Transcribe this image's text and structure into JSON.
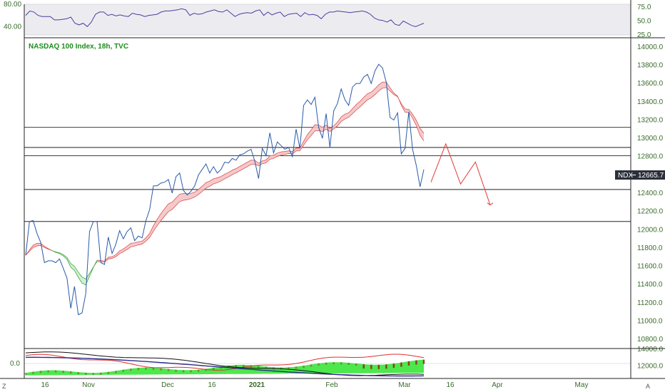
{
  "title": "NASDAQ 100 Index, 18h, TVC",
  "badge": {
    "symbol": "NDX",
    "price": "12665.7"
  },
  "corner_buttons": {
    "left": "Z",
    "right": "A"
  },
  "colors": {
    "price": "#2b5aa8",
    "rsi": "#4b3d9c",
    "ribbon_up_fill": "#c9eec9",
    "ribbon_up_stroke": "#2e9b2e",
    "ribbon_down_fill": "#f3bfbf",
    "ribbon_down_stroke": "#d64040",
    "projection": "#e23a3a",
    "levels": "#222222",
    "histogram": "#39e639",
    "histogram_dark": "#9b1b1b",
    "indicator_line1": "#e03030",
    "indicator_line2": "#111111",
    "indicator_line3": "#2d2a8a",
    "axis_text": "#3a6b2c"
  },
  "chart_data": [
    {
      "type": "line",
      "panel": "rsi",
      "y_ticks": [
        "80.00",
        "40.00"
      ],
      "right_ticks": [
        "75.0",
        "50.0",
        "25.0"
      ],
      "ylim": [
        25,
        80
      ],
      "values": [
        60,
        68,
        66,
        60,
        58,
        58,
        58,
        52,
        52,
        53,
        54,
        57,
        46,
        43,
        46,
        40,
        48,
        62,
        66,
        66,
        60,
        62,
        59,
        61,
        59,
        58,
        64,
        62,
        61,
        58,
        60,
        61,
        62,
        66,
        68,
        68,
        69,
        70,
        72,
        70,
        60,
        64,
        62,
        63,
        66,
        68,
        70,
        67,
        66,
        70,
        64,
        58,
        62,
        64,
        65,
        64,
        68,
        70,
        60,
        66,
        61,
        64,
        66,
        58,
        62,
        63,
        64,
        58,
        65,
        61,
        62,
        60,
        54,
        62,
        66,
        66,
        68,
        67,
        66,
        65,
        66,
        67,
        68,
        66,
        62,
        55,
        52,
        51,
        48,
        52,
        44,
        42,
        50,
        46,
        42,
        40,
        43,
        46
      ]
    },
    {
      "type": "line",
      "panel": "price",
      "xlabel": "",
      "ylabel": "",
      "y_ticks": [
        "14000.0",
        "13800.0",
        "13600.0",
        "13400.0",
        "13200.0",
        "13000.0",
        "12800.0",
        "12600.0",
        "12400.0",
        "12200.0",
        "12000.0",
        "11800.0",
        "11600.0",
        "11400.0",
        "11200.0",
        "11000.0",
        "10800.0"
      ],
      "ylim": [
        10700,
        14100
      ],
      "x_ticks": [
        "16",
        "Nov",
        "Dec",
        "16",
        "2021",
        "Feb",
        "Mar",
        "16",
        "Apr",
        "May"
      ],
      "series": [
        {
          "role": "price",
          "values": [
            11720,
            12090,
            12100,
            11960,
            11860,
            11640,
            11660,
            11660,
            11640,
            11680,
            11580,
            11470,
            11140,
            11380,
            11070,
            11090,
            11300,
            11980,
            12090,
            12090,
            11640,
            11620,
            11920,
            11740,
            11840,
            11990,
            11900,
            11980,
            12020,
            11880,
            11930,
            11910,
            12100,
            12220,
            12480,
            12480,
            12510,
            12520,
            12550,
            12400,
            12580,
            12620,
            12430,
            12380,
            12420,
            12480,
            12600,
            12660,
            12720,
            12620,
            12690,
            12620,
            12660,
            12740,
            12730,
            12780,
            12760,
            12820,
            12830,
            12860,
            12880,
            12750,
            12560,
            12890,
            12810,
            13060,
            12840,
            12960,
            12920,
            12880,
            12900,
            12800,
            13100,
            12890,
            13360,
            13420,
            13370,
            13450,
            13120,
            13000,
            13270,
            12900,
            13300,
            13380,
            13540,
            13420,
            13360,
            13560,
            13600,
            13600,
            13670,
            13700,
            13600,
            13740,
            13810,
            13770,
            13610,
            13230,
            13200,
            13280,
            12830,
            12890,
            13290,
            12880,
            12700,
            12470,
            12660
          ]
        },
        {
          "role": "projection",
          "values": [
            12520,
            12940,
            12500,
            12740,
            12270
          ]
        }
      ],
      "levels": [
        13120,
        12900,
        12810,
        12440,
        12090
      ],
      "annotations": []
    },
    {
      "type": "line",
      "panel": "indicator",
      "y_ticks": [
        "0.0"
      ],
      "right_ticks": [
        "14000.0",
        "12000.0"
      ],
      "ylim": [
        -1.2,
        1.2
      ]
    }
  ]
}
